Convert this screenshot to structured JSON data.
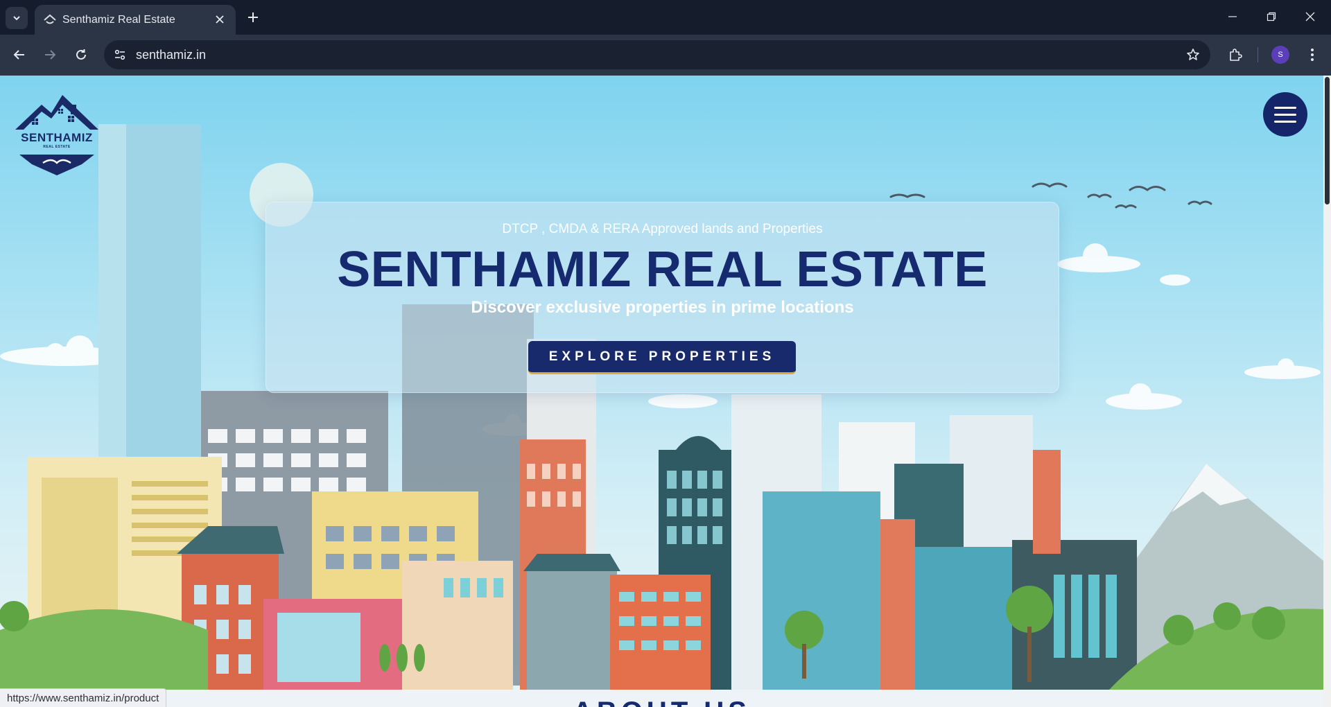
{
  "browser": {
    "tab_title": "Senthamiz Real Estate",
    "url": "senthamiz.in",
    "profile_initial": "S",
    "status_url": "https://www.senthamiz.in/product"
  },
  "site": {
    "logo_text": "SENTHAMIZ",
    "logo_subtext": "REAL ESTATE",
    "hero": {
      "kicker": "DTCP , CMDA & RERA Approved lands and Properties",
      "headline": "SENTHAMIZ REAL ESTATE",
      "tagline": "Discover exclusive properties in prime locations",
      "cta_label": "EXPLORE PROPERTIES"
    },
    "next_section_title": "ABOUT US"
  },
  "colors": {
    "brand_navy": "#152a6f",
    "cta_accent": "#e0a93a",
    "sky": "#8fd6ee"
  },
  "icons": {
    "menu": "hamburger-icon",
    "back": "arrow-left-icon",
    "forward": "arrow-right-icon",
    "reload": "reload-icon",
    "bookmark": "star-icon",
    "extensions": "puzzle-icon",
    "more": "kebab-icon"
  }
}
